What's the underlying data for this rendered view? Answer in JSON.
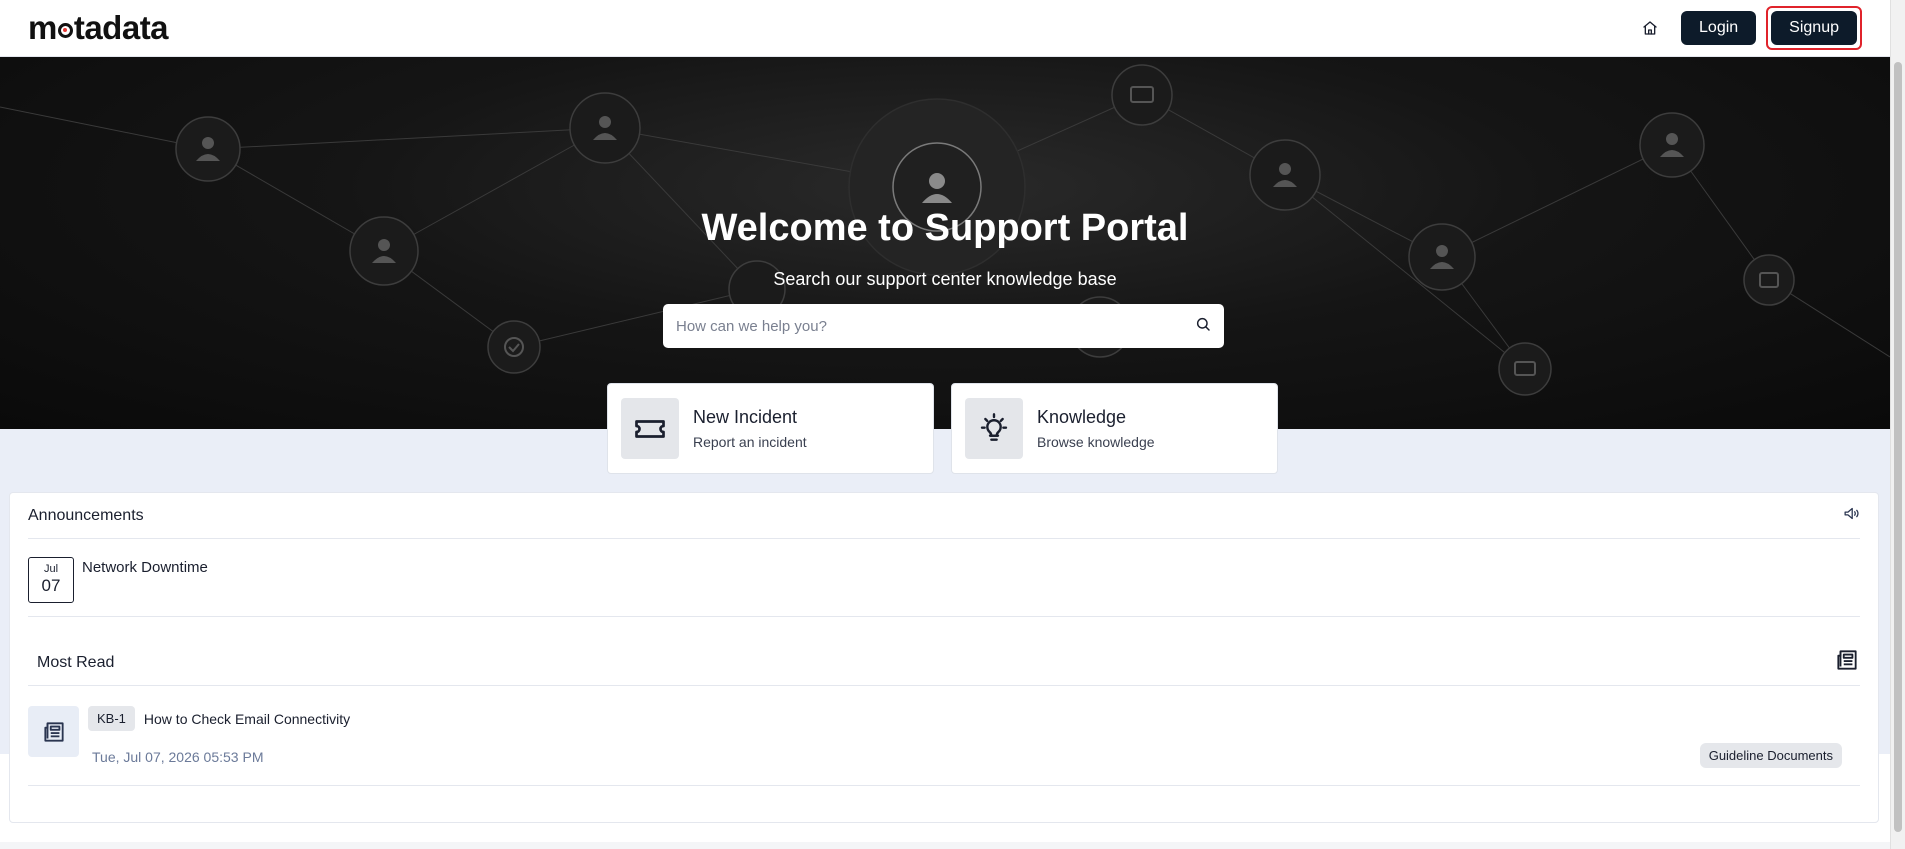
{
  "header": {
    "logo": "motadata",
    "home_icon": "home-icon",
    "login_label": "Login",
    "signup_label": "Signup"
  },
  "hero": {
    "title": "Welcome to Support Portal",
    "subtitle": "Search our support center knowledge base",
    "search_placeholder": "How can we help you?",
    "search_icon": "search-icon"
  },
  "actions": [
    {
      "title": "New Incident",
      "subtitle": "Report an incident",
      "icon": "ticket-icon"
    },
    {
      "title": "Knowledge",
      "subtitle": "Browse knowledge",
      "icon": "lightbulb-icon"
    }
  ],
  "announcements": {
    "title": "Announcements",
    "icon": "megaphone-icon",
    "items": [
      {
        "month": "Jul",
        "day": "07",
        "title": "Network Downtime"
      }
    ]
  },
  "most_read": {
    "title": "Most Read",
    "icon": "newspaper-icon",
    "items": [
      {
        "id": "KB-1",
        "title": "How to Check Email Connectivity",
        "date": "Tue, Jul 07, 2026 05:53 PM",
        "category": "Guideline Documents"
      }
    ]
  }
}
